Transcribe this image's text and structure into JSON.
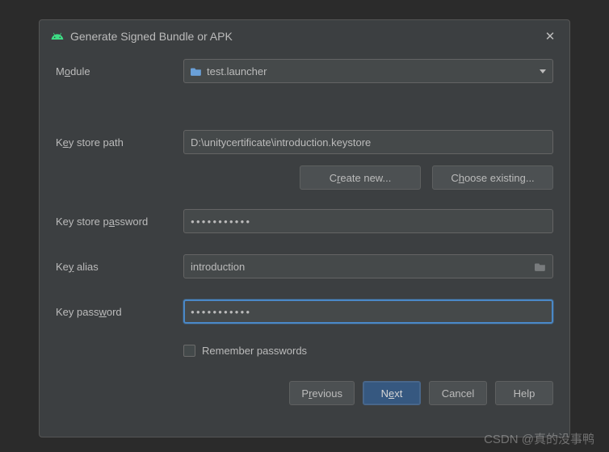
{
  "dialog": {
    "title": "Generate Signed Bundle or APK"
  },
  "labels": {
    "module_pre": "M",
    "module_ul": "o",
    "module_post": "dule",
    "ksp_pre": "K",
    "ksp_ul": "e",
    "ksp_post": "y store path",
    "kspw_pre": "Key store p",
    "kspw_ul": "a",
    "kspw_post": "ssword",
    "ka_pre": "Ke",
    "ka_ul": "y",
    "ka_post": " alias",
    "kpw_pre": "Key pass",
    "kpw_ul": "w",
    "kpw_post": "ord",
    "rem_pre": "R",
    "rem_ul": "e",
    "rem_post": "member passwords"
  },
  "fields": {
    "module": "test.launcher",
    "keystore_path": "D:\\unitycertificate\\introduction.keystore",
    "keystore_password": "●●●●●●●●●●●",
    "key_alias": "introduction",
    "key_password": "●●●●●●●●●●●"
  },
  "buttons": {
    "cn_pre": "C",
    "cn_ul": "r",
    "cn_post": "eate new...",
    "ce_pre": "C",
    "ce_ul": "h",
    "ce_post": "oose existing...",
    "prev_pre": "P",
    "prev_ul": "r",
    "prev_post": "evious",
    "next_pre": "N",
    "next_ul": "e",
    "next_post": "xt",
    "cancel": "Cancel",
    "help": "Help"
  },
  "watermark": "CSDN @真的没事鸭"
}
